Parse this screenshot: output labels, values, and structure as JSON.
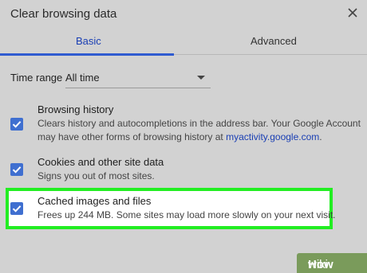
{
  "dialog": {
    "title": "Clear browsing data",
    "close_icon": "close-icon"
  },
  "tabs": [
    {
      "label": "Basic",
      "active": true
    },
    {
      "label": "Advanced",
      "active": false
    }
  ],
  "time_range": {
    "label": "Time range",
    "value": "All time"
  },
  "items": [
    {
      "title": "Browsing history",
      "desc_line1": "Clears history and autocompletions in the address bar. Your Google Account",
      "desc_line2_prefix": "may have other forms of browsing history at ",
      "desc_link": "myactivity.google.com",
      "desc_line2_suffix": ".",
      "checked": true
    },
    {
      "title": "Cookies and other site data",
      "desc_line1": "Signs you out of most sites.",
      "checked": true
    },
    {
      "title": "Cached images and files",
      "desc_line1": "Frees up 244 MB. Some sites may load more slowly on your next visit.",
      "checked": true
    }
  ],
  "watermark": {
    "part1": "wiki",
    "part2": "How"
  },
  "colors": {
    "accent": "#2f5bd0",
    "checkbox": "#3f6fd0",
    "highlight_border": "#22ee22",
    "background": "#d2d2d2",
    "watermark_bg": "#7a9b5b"
  }
}
